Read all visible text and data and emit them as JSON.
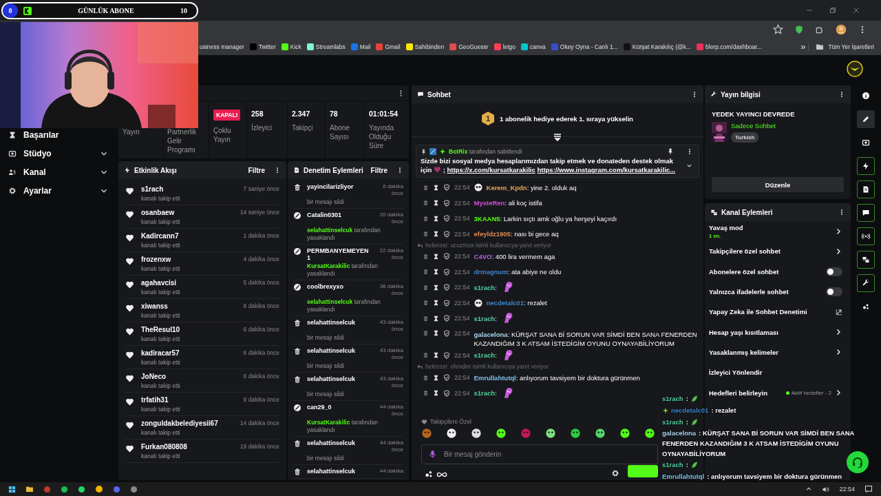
{
  "goal_bar": {
    "current": "0",
    "title": "GÜNLÜK ABONE",
    "target": "10",
    "level": 0
  },
  "browser": {
    "bookmarks": [
      {
        "label": "usiness manager"
      },
      {
        "label": "Twitter",
        "color": "#000000"
      },
      {
        "label": "Kick",
        "color": "#53fc18"
      },
      {
        "label": "Streamlabs",
        "color": "#80f5d2"
      },
      {
        "label": "Mail",
        "color": "#1a73e8"
      },
      {
        "label": "Gmail",
        "color": "#ea4335"
      },
      {
        "label": "Sahibinden",
        "color": "#ffe800"
      },
      {
        "label": "GeoGuessr",
        "color": "#e34c4c"
      },
      {
        "label": "letgo",
        "color": "#ff3f55"
      },
      {
        "label": "canva",
        "color": "#00c4cc"
      },
      {
        "label": "Okey Oyna - Canlı 1...",
        "color": "#3b4bd0"
      },
      {
        "label": "Kürşat Karakılıç (@k...",
        "color": "#111111"
      },
      {
        "label": "blerp.com/dashboar...",
        "color": "#e8315b"
      }
    ],
    "more": "»",
    "all_bookmarks": "Tüm Yer İşaretleri"
  },
  "sidebar": {
    "items": [
      {
        "label": "Başarılar",
        "expandable": false
      },
      {
        "label": "Stüdyo",
        "expandable": true
      },
      {
        "label": "Kanal",
        "expandable": true
      },
      {
        "label": "Ayarlar",
        "expandable": true
      }
    ]
  },
  "stats": [
    {
      "label": "Yayın"
    },
    {
      "label": "Partnerlik Gelir Programı"
    },
    {
      "badge": "KAPALI",
      "label": "Çoklu Yayın"
    },
    {
      "value": "258",
      "label": "İzleyici"
    },
    {
      "value": "2.347",
      "label": "Takipçi"
    },
    {
      "value": "78",
      "label": "Abone Sayısı"
    },
    {
      "value": "01:01:54",
      "label": "Yayında Olduğu Süre"
    }
  ],
  "activity_feed": {
    "title": "Etkinlik Akışı",
    "filter": "Filtre",
    "events": [
      {
        "user": "s1rach",
        "action": "kanalı takip etti",
        "time": "7 saniye önce"
      },
      {
        "user": "osanbaew",
        "action": "kanalı takip etti",
        "time": "14 saniye önce"
      },
      {
        "user": "Kadircann7",
        "action": "kanalı takip etti",
        "time": "1 dakika önce"
      },
      {
        "user": "frozenxw",
        "action": "kanalı takip etti",
        "time": "4 dakika önce"
      },
      {
        "user": "agahavcisi",
        "action": "kanalı takip etti",
        "time": "5 dakika önce"
      },
      {
        "user": "xiwanss",
        "action": "kanalı takip etti",
        "time": "6 dakika önce"
      },
      {
        "user": "TheResul10",
        "action": "kanalı takip etti",
        "time": "6 dakika önce"
      },
      {
        "user": "kadiracar57",
        "action": "kanalı takip etti",
        "time": "6 dakika önce"
      },
      {
        "user": "JoNeco",
        "action": "kanalı takip etti",
        "time": "6 dakika önce"
      },
      {
        "user": "trfatih31",
        "action": "kanalı takip etti",
        "time": "9 dakika önce"
      },
      {
        "user": "zonguldakbelediyesii67",
        "action": "kanalı takip etti",
        "time": "14 dakika önce"
      },
      {
        "user": "Furkan080808",
        "action": "kanalı takip etti",
        "time": "19 dakika önce"
      }
    ]
  },
  "mod_actions": {
    "title": "Denetim Eylemleri",
    "filter": "Filtre",
    "items": [
      {
        "kind": "delete",
        "user": "yayincilarizliyor",
        "time": "6 dakika önce",
        "action": "bir mesajı sildi"
      },
      {
        "kind": "ban",
        "user": "Catalin0301",
        "time": "20 dakika önce",
        "moderator": "selahattinselcuk",
        "action": "tarafından yasaklandı"
      },
      {
        "kind": "ban",
        "user": "PERMBANYEMEYEN1",
        "time": "22 dakika önce",
        "moderator": "KursatKarakilic",
        "action": "tarafından yasaklandı"
      },
      {
        "kind": "ban",
        "user": "coolbrexyxo",
        "time": "36 dakika önce",
        "moderator": "selahattinselcuk",
        "action": "tarafından yasaklandı"
      },
      {
        "kind": "delete",
        "user": "selahattinselcuk",
        "time": "43 dakika önce",
        "action": "bir mesajı sildi"
      },
      {
        "kind": "delete",
        "user": "selahattinselcuk",
        "time": "43 dakika önce",
        "action": "bir mesajı sildi"
      },
      {
        "kind": "delete",
        "user": "selahattinselcuk",
        "time": "43 dakika önce",
        "action": "bir mesajı sildi"
      },
      {
        "kind": "ban",
        "user": "can29_0",
        "time": "44 dakika önce",
        "moderator": "KursatKarakilic",
        "action": "tarafından yasaklandı"
      },
      {
        "kind": "delete",
        "user": "selahattinselcuk",
        "time": "44 dakika önce",
        "action": "bir mesajı sildi"
      },
      {
        "kind": "delete",
        "user": "selahattinselcuk",
        "time": "44 dakika"
      }
    ]
  },
  "chat": {
    "title": "Sohbet",
    "promo_rank": "1",
    "promo": "1 abonelik hediye ederek 1. sıraya yükselin",
    "pinned": {
      "by": "BotRix",
      "by_suffix": "tarafından sabitlendi",
      "text": "Sizde bizi sosyal medya hesaplarımızdan takip etmek ve donateden destek olmak için",
      "separator": ";",
      "links": [
        "https://x.com/kursatkarakilic",
        "https://www.instagram.com/kursatkarakilic..."
      ]
    },
    "messages": [
      {
        "kind": "text",
        "time": "22:54",
        "user": "Kerem_Kpdn",
        "color": "#e2a85a",
        "badge": true,
        "text": ": yine 2. olduk aq"
      },
      {
        "kind": "text",
        "time": "22:54",
        "user": "MysteRen",
        "color": "#d24fd6",
        "badge": false,
        "text": ": ali koç istifa"
      },
      {
        "kind": "text",
        "time": "22:54",
        "user": "3KAAN5",
        "color": "#53fc18",
        "badge": false,
        "text": ": Larkin sıçtı amk oğlu ya herşeyi kaçırdı"
      },
      {
        "kind": "text",
        "time": "22:54",
        "user": "efeyldz1905",
        "color": "#e0894c",
        "badge": false,
        "text": ": nası bi gece aq"
      },
      {
        "kind": "reply",
        "text": "helenzei: ucuzmus isimli kullanıcıya yanıt veriyor"
      },
      {
        "kind": "text",
        "time": "22:54",
        "user": "C4VO",
        "color": "#b45fe0",
        "badge": false,
        "text": ": 400 lira vermem aga"
      },
      {
        "kind": "text",
        "time": "22:54",
        "user": "drmagnum",
        "color": "#3f84c8",
        "badge": false,
        "text": ": ata abiye ne oldu"
      },
      {
        "kind": "emote",
        "time": "22:54",
        "user": "s1rach",
        "color": "#4fd1a0",
        "badge": false,
        "text": ":"
      },
      {
        "kind": "text",
        "time": "22:54",
        "user": "necdetalc01",
        "color": "#3f84c8",
        "badge": true,
        "text": ": rezalet"
      },
      {
        "kind": "emote",
        "time": "22:54",
        "user": "s1rach",
        "color": "#4fd1a0",
        "badge": false,
        "text": ":"
      },
      {
        "kind": "text",
        "time": "22:54",
        "user": "galacelona",
        "color": "#a9d4ef",
        "badge": false,
        "text": ": KÜRŞAT SANA Bİ SORUN VAR SİMDİ BEN SANA FENERDEN KAZANDIĞIM 3 K ATSAM İSTEDİGİM OYUNU OYNAYABİLİYORUM"
      },
      {
        "kind": "emote",
        "time": "22:54",
        "user": "s1rach",
        "color": "#4fd1a0",
        "badge": false,
        "text": ":"
      },
      {
        "kind": "reply",
        "text": "helenzei: efendim isimli kullanıcıya yanıt veriyor"
      },
      {
        "kind": "text",
        "time": "22:54",
        "user": "Emrullahtutql",
        "color": "#7fc0e8",
        "badge": false,
        "text": ": anlıyorum tavsiyem bir doktura gürünmen"
      },
      {
        "kind": "emote",
        "time": "22:54",
        "user": "s1rach",
        "color": "#4fd1a0",
        "badge": false,
        "text": ":"
      }
    ],
    "emote_section": "Takipçilere Özel",
    "emotes": [
      {
        "color": "#b5651d"
      },
      {
        "color": "#eeeeee"
      },
      {
        "color": "#dddddd"
      },
      {
        "color": "#53fc18"
      },
      {
        "color": "#c2185b"
      },
      {
        "color": "#7ee07e"
      },
      {
        "color": "#2ecc40"
      },
      {
        "color": "#55d46a"
      },
      {
        "color": "#53fc18"
      },
      {
        "color": "#53fc18"
      }
    ],
    "input": {
      "placeholder": "Bir mesaj gönderin"
    }
  },
  "stream_info": {
    "title": "Yayın bilgisi",
    "status": "YEDEK YAYINCI DEVREDE",
    "category": "Sadece Sohbet",
    "tag": "Turkish",
    "edit": "Düzenle"
  },
  "channel_actions": {
    "title": "Kanal Eylemleri",
    "items": [
      {
        "kind": "link",
        "label": "Yavaş mod",
        "sub": "1 sn."
      },
      {
        "kind": "link",
        "label": "Takipçilere özel sohbet"
      },
      {
        "kind": "toggle",
        "label": "Abonelere özel sohbet",
        "on": false
      },
      {
        "kind": "toggle",
        "label": "Yalnızca ifadelerle sohbet",
        "on": false
      },
      {
        "kind": "external",
        "label": "Yapay Zeka ile Sohbet Denetimi"
      },
      {
        "kind": "link",
        "label": "Hesap yaşı kısıtlaması"
      },
      {
        "kind": "link",
        "label": "Yasaklanmış kelimeler"
      },
      {
        "kind": "plain",
        "label": "İzleyici Yönlendir"
      },
      {
        "kind": "link",
        "label": "Hedefleri belirleyin",
        "status": "Aktif hedefler - 2"
      }
    ]
  },
  "rail": [
    {
      "selected": false,
      "highlighted": false
    },
    {
      "selected": true,
      "highlighted": false
    },
    {
      "selected": false,
      "highlighted": false
    },
    {
      "selected": false,
      "highlighted": true
    },
    {
      "selected": false,
      "highlighted": true
    },
    {
      "selected": false,
      "highlighted": true
    },
    {
      "selected": false,
      "highlighted": true
    },
    {
      "selected": false,
      "highlighted": true
    },
    {
      "selected": false,
      "highlighted": true
    },
    {
      "selected": false,
      "highlighted": false
    }
  ],
  "chat_overlay": [
    {
      "kind": "emote",
      "user": "s1rach",
      "color": "#4fd1a0",
      "badge": false,
      "text": ":"
    },
    {
      "kind": "text",
      "user": "necdetalc01",
      "color": "#3f84c8",
      "badge": true,
      "text": ": rezalet"
    },
    {
      "kind": "emote",
      "user": "s1rach",
      "color": "#4fd1a0",
      "badge": false,
      "text": ":"
    },
    {
      "kind": "text",
      "user": "galacelona",
      "color": "#a9d4ef",
      "badge": false,
      "text": ": KÜRŞAT SANA Bİ SORUN VAR SİMDİ BEN SANA FENERDEN KAZANDIĞIM 3 K ATSAM İSTEDİGİM OYUNU OYNAYABİLİYORUM"
    },
    {
      "kind": "emote",
      "user": "s1rach",
      "color": "#4fd1a0",
      "badge": false,
      "text": ":"
    },
    {
      "kind": "text",
      "user": "Emrullahtutql",
      "color": "#7fc0e8",
      "badge": false,
      "text": ": anlıyorum tavsiyem bir doktura gürünmen"
    }
  ],
  "taskbar": {
    "time": "22:54"
  }
}
